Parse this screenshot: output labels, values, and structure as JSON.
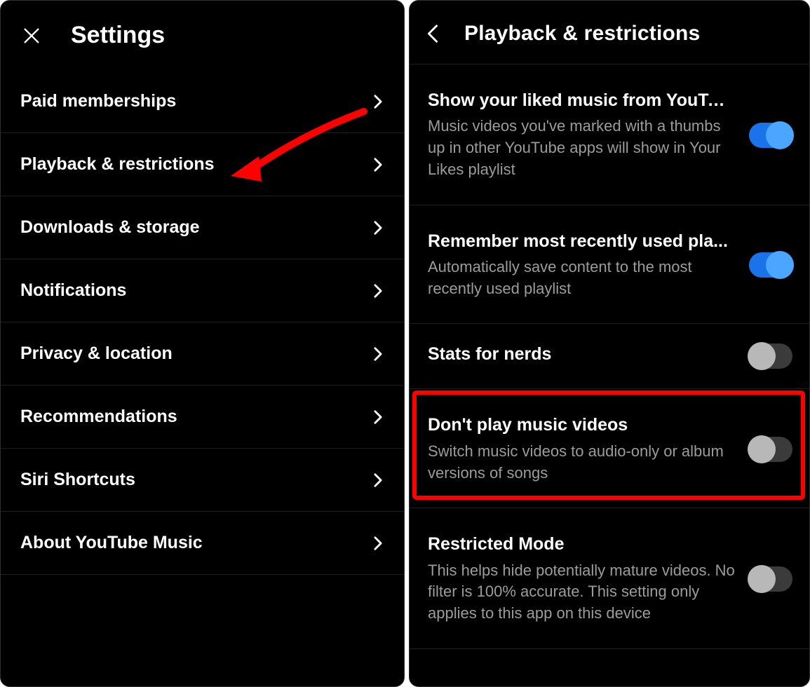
{
  "settings": {
    "title": "Settings",
    "items": [
      {
        "label": "Paid memberships"
      },
      {
        "label": "Playback & restrictions"
      },
      {
        "label": "Downloads & storage"
      },
      {
        "label": "Notifications"
      },
      {
        "label": "Privacy & location"
      },
      {
        "label": "Recommendations"
      },
      {
        "label": "Siri Shortcuts"
      },
      {
        "label": "About YouTube Music"
      }
    ]
  },
  "playback": {
    "title": "Playback & restrictions",
    "entries": [
      {
        "title": "Show your liked music from YouTu...",
        "desc": "Music videos you've marked with a thumbs up in other YouTube apps will show in Your Likes playlist",
        "on": true
      },
      {
        "title": "Remember most recently used pla...",
        "desc": "Automatically save content to the most recently used playlist",
        "on": true
      },
      {
        "title": "Stats for nerds",
        "desc": "",
        "on": false
      },
      {
        "title": "Don't play music videos",
        "desc": "Switch music videos to audio-only or album versions of songs",
        "on": false
      },
      {
        "title": "Restricted Mode",
        "desc": "This helps hide potentially mature videos. No filter is 100% accurate. This setting only applies to this app on this device",
        "on": false
      }
    ]
  },
  "colors": {
    "accent": "#1a73e8",
    "highlight": "#ff0000"
  }
}
